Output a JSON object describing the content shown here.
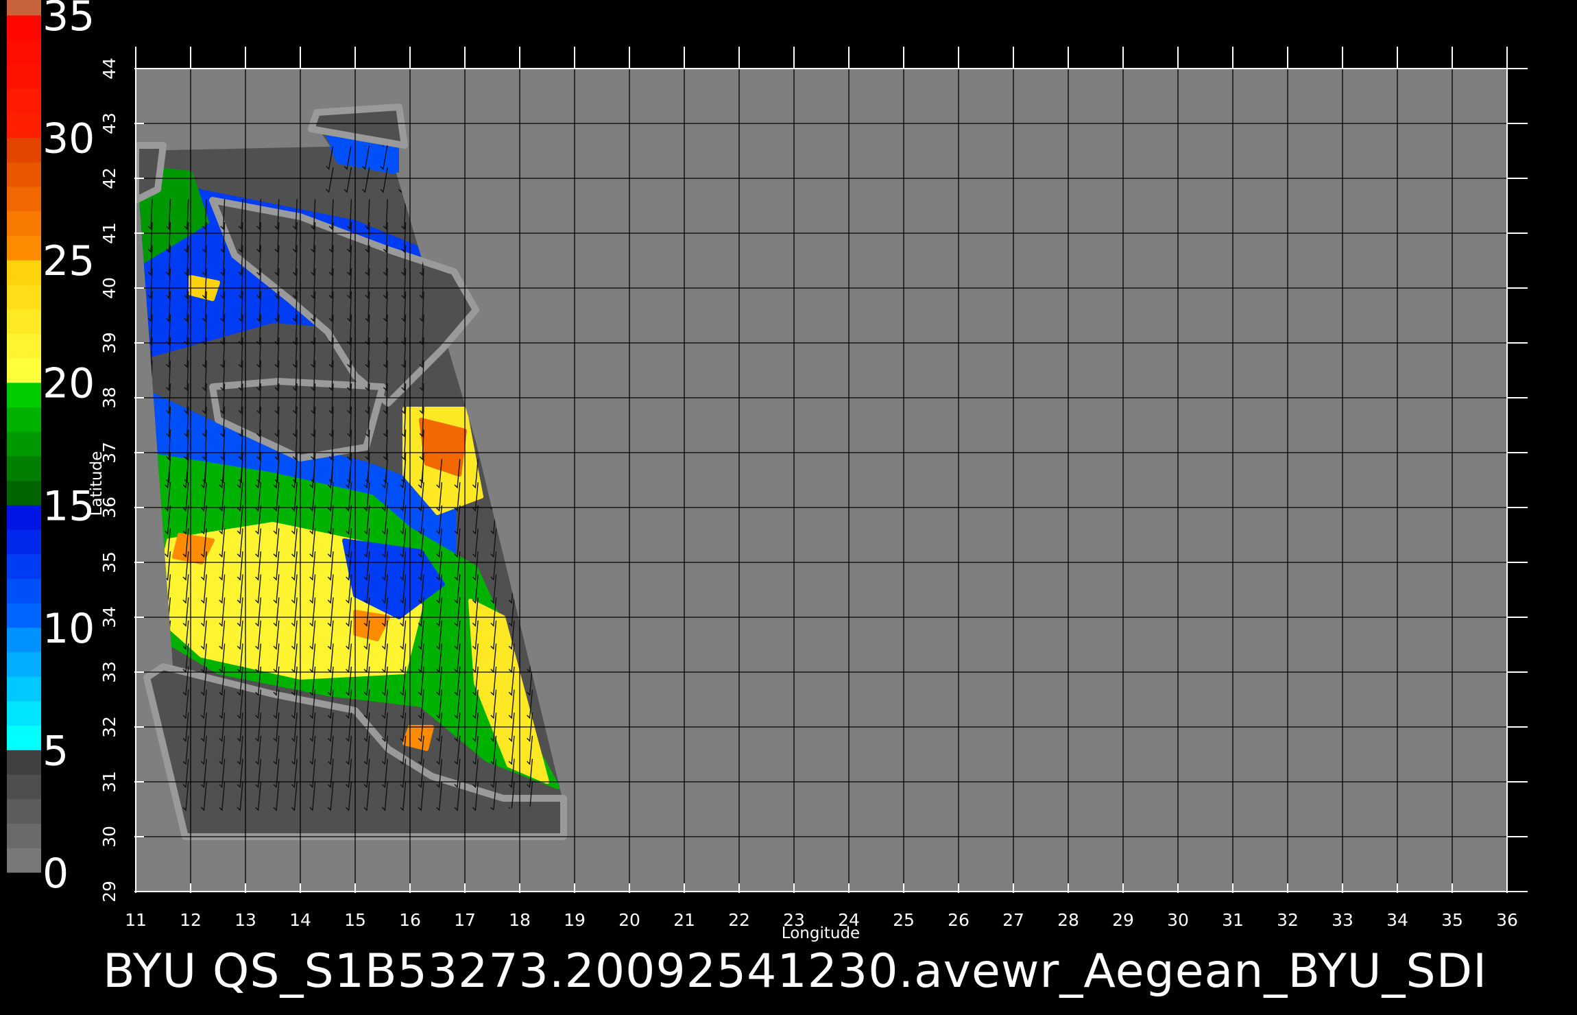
{
  "caption": "BYU  QS_S1B53273.20092541230.avewr_Aegean_BYU_SDI",
  "map": {
    "x_label": "Longitude",
    "y_label": "Latitude",
    "lon_range": [
      11,
      36
    ],
    "lat_range": [
      29,
      44
    ],
    "lon_ticks": [
      "11",
      "12",
      "13",
      "14",
      "15",
      "16",
      "17",
      "18",
      "19",
      "20",
      "21",
      "22",
      "23",
      "24",
      "25",
      "26",
      "27",
      "28",
      "29",
      "30",
      "31",
      "32",
      "33",
      "34",
      "35",
      "36"
    ],
    "lat_ticks": [
      "29",
      "30",
      "31",
      "32",
      "33",
      "34",
      "35",
      "36",
      "37",
      "38",
      "39",
      "40",
      "41",
      "42",
      "43",
      "44"
    ],
    "grid": true,
    "no_data_color": "#7f7f7f",
    "swath_background_color": "#505050"
  },
  "colorbar": {
    "unit_range": [
      0,
      35
    ],
    "labels": [
      "0",
      "5",
      "10",
      "15",
      "20",
      "25",
      "30",
      "35"
    ],
    "bands": [
      {
        "from": 0,
        "to": 5,
        "colors": [
          "#787878",
          "#323232"
        ]
      },
      {
        "from": 5,
        "to": 10,
        "colors": [
          "#00ffff",
          "#0078ff"
        ]
      },
      {
        "from": 10,
        "to": 15,
        "colors": [
          "#0064ff",
          "#0000e0"
        ]
      },
      {
        "from": 15,
        "to": 20,
        "colors": [
          "#006400",
          "#00e600"
        ]
      },
      {
        "from": 20,
        "to": 25,
        "colors": [
          "#ffff3c",
          "#ffc800"
        ]
      },
      {
        "from": 25,
        "to": 30,
        "colors": [
          "#ff8c00",
          "#dc3200"
        ]
      },
      {
        "from": 30,
        "to": 35,
        "colors": [
          "#ff2000",
          "#ff0000"
        ]
      },
      {
        "from": 35,
        "to": 36,
        "colors": [
          "#c8643c",
          "#c8643c"
        ]
      }
    ]
  },
  "swath": {
    "outline_lon_lat": [
      [
        11.0,
        42.5
      ],
      [
        15.6,
        42.6
      ],
      [
        17.2,
        37.2
      ],
      [
        18.8,
        30.6
      ],
      [
        11.9,
        30.0
      ]
    ],
    "north_patch_lon_lat": [
      [
        14.2,
        43.1
      ],
      [
        15.8,
        43.2
      ],
      [
        15.7,
        42.3
      ],
      [
        14.8,
        42.2
      ]
    ],
    "regions": [
      {
        "level": 12,
        "polygon": [
          [
            11.0,
            42.0
          ],
          [
            13.0,
            41.6
          ],
          [
            15.0,
            41.2
          ],
          [
            16.7,
            40.5
          ],
          [
            16.3,
            39.2
          ],
          [
            13.5,
            39.4
          ],
          [
            11.0,
            38.7
          ]
        ]
      },
      {
        "level": 8,
        "polygon": [
          [
            13.6,
            41.1
          ],
          [
            15.5,
            40.6
          ],
          [
            16.1,
            39.7
          ],
          [
            15.0,
            39.3
          ],
          [
            13.8,
            39.8
          ]
        ]
      },
      {
        "level": 11,
        "polygon": [
          [
            14.3,
            43.1
          ],
          [
            15.8,
            43.1
          ],
          [
            15.8,
            42.1
          ],
          [
            14.7,
            42.3
          ]
        ]
      },
      {
        "level": 17,
        "polygon": [
          [
            11.0,
            42.2
          ],
          [
            12.0,
            42.1
          ],
          [
            12.3,
            41.2
          ],
          [
            11.0,
            40.4
          ]
        ]
      },
      {
        "level": 11,
        "polygon": [
          [
            11.0,
            38.2
          ],
          [
            12.7,
            37.4
          ],
          [
            15.2,
            36.8
          ],
          [
            16.8,
            36.2
          ],
          [
            16.8,
            35.0
          ],
          [
            14.5,
            35.5
          ],
          [
            12.0,
            36.3
          ],
          [
            11.0,
            36.8
          ]
        ]
      },
      {
        "level": 18,
        "polygon": [
          [
            11.0,
            37.0
          ],
          [
            13.5,
            36.6
          ],
          [
            15.3,
            36.2
          ],
          [
            16.0,
            35.6
          ],
          [
            17.2,
            34.9
          ],
          [
            17.7,
            33.8
          ],
          [
            18.2,
            31.8
          ],
          [
            18.7,
            30.9
          ],
          [
            17.4,
            31.4
          ],
          [
            16.2,
            32.4
          ],
          [
            14.5,
            32.6
          ],
          [
            12.5,
            33.0
          ],
          [
            11.0,
            33.9
          ]
        ]
      },
      {
        "level": 21,
        "polygon": [
          [
            11.6,
            35.4
          ],
          [
            13.5,
            35.7
          ],
          [
            15.4,
            35.3
          ],
          [
            16.2,
            34.2
          ],
          [
            15.9,
            33.0
          ],
          [
            14.0,
            32.9
          ],
          [
            12.2,
            33.3
          ],
          [
            11.3,
            34.1
          ]
        ]
      },
      {
        "level": 22,
        "polygon": [
          [
            17.1,
            34.3
          ],
          [
            17.7,
            34.0
          ],
          [
            18.5,
            31.0
          ],
          [
            17.8,
            31.3
          ],
          [
            17.2,
            32.8
          ]
        ]
      },
      {
        "level": 22,
        "polygon": [
          [
            15.9,
            37.8
          ],
          [
            17.0,
            37.8
          ],
          [
            17.3,
            36.2
          ],
          [
            16.5,
            35.9
          ],
          [
            15.9,
            36.6
          ]
        ]
      },
      {
        "level": 27,
        "polygon": [
          [
            16.2,
            37.6
          ],
          [
            17.0,
            37.4
          ],
          [
            16.9,
            36.6
          ],
          [
            16.3,
            36.8
          ]
        ]
      },
      {
        "level": 12,
        "polygon": [
          [
            14.8,
            35.4
          ],
          [
            16.2,
            35.2
          ],
          [
            16.6,
            34.6
          ],
          [
            15.8,
            34.0
          ],
          [
            15.0,
            34.4
          ]
        ]
      },
      {
        "level": 25,
        "polygon": [
          [
            11.8,
            35.5
          ],
          [
            12.4,
            35.4
          ],
          [
            12.2,
            35.0
          ],
          [
            11.7,
            35.1
          ]
        ]
      },
      {
        "level": 25,
        "polygon": [
          [
            15.0,
            34.1
          ],
          [
            15.6,
            34.0
          ],
          [
            15.4,
            33.6
          ],
          [
            15.0,
            33.7
          ]
        ]
      },
      {
        "level": 25,
        "polygon": [
          [
            16.0,
            32.0
          ],
          [
            16.4,
            32.0
          ],
          [
            16.3,
            31.6
          ],
          [
            15.9,
            31.7
          ]
        ]
      },
      {
        "level": 24,
        "polygon": [
          [
            12.0,
            40.2
          ],
          [
            12.5,
            40.1
          ],
          [
            12.4,
            39.8
          ],
          [
            12.0,
            39.9
          ]
        ]
      },
      {
        "level": 3,
        "polygon": [
          [
            13.3,
            40.6
          ],
          [
            13.9,
            40.6
          ],
          [
            13.8,
            40.2
          ],
          [
            13.3,
            40.3
          ]
        ]
      },
      {
        "level": 3,
        "polygon": [
          [
            14.6,
            39.9
          ],
          [
            15.1,
            39.9
          ],
          [
            15.0,
            39.5
          ],
          [
            14.6,
            39.6
          ]
        ]
      }
    ],
    "land": [
      {
        "name": "italy-peninsula",
        "polygon": [
          [
            12.4,
            41.6
          ],
          [
            14.0,
            41.3
          ],
          [
            15.6,
            40.7
          ],
          [
            16.8,
            40.3
          ],
          [
            17.2,
            39.6
          ],
          [
            16.6,
            38.9
          ],
          [
            15.9,
            38.2
          ],
          [
            15.6,
            37.9
          ],
          [
            15.0,
            38.4
          ],
          [
            14.5,
            39.2
          ],
          [
            13.8,
            39.8
          ],
          [
            12.8,
            40.6
          ]
        ]
      },
      {
        "name": "sicily",
        "polygon": [
          [
            12.4,
            38.2
          ],
          [
            13.6,
            38.3
          ],
          [
            15.5,
            38.2
          ],
          [
            15.2,
            37.1
          ],
          [
            14.0,
            36.9
          ],
          [
            12.5,
            37.6
          ]
        ]
      },
      {
        "name": "sardinia-corsica",
        "polygon": [
          [
            11.0,
            42.6
          ],
          [
            11.5,
            42.6
          ],
          [
            11.4,
            41.8
          ],
          [
            11.0,
            41.6
          ]
        ]
      },
      {
        "name": "croatia-coast",
        "polygon": [
          [
            14.3,
            43.2
          ],
          [
            15.8,
            43.3
          ],
          [
            15.9,
            42.6
          ],
          [
            14.2,
            42.9
          ]
        ]
      },
      {
        "name": "libya-coast",
        "polygon": [
          [
            11.5,
            33.1
          ],
          [
            13.5,
            32.6
          ],
          [
            15.0,
            32.3
          ],
          [
            15.6,
            31.6
          ],
          [
            16.4,
            31.1
          ],
          [
            17.7,
            30.7
          ],
          [
            18.8,
            30.7
          ],
          [
            18.8,
            30.0
          ],
          [
            11.9,
            30.0
          ],
          [
            11.2,
            32.9
          ]
        ]
      }
    ]
  },
  "wind_vectors": {
    "length_deg": 0.55,
    "fields": [
      {
        "lon": [
          11.3,
          16.5
        ],
        "lat": [
          37.0,
          41.8
        ],
        "dir_deg": 260
      },
      {
        "lon": [
          11.3,
          18.5
        ],
        "lat": [
          31.0,
          36.9
        ],
        "dir_deg": 250
      },
      {
        "lon": [
          14.6,
          16.0
        ],
        "lat": [
          42.2,
          43.8
        ],
        "dir_deg": 235
      }
    ]
  }
}
